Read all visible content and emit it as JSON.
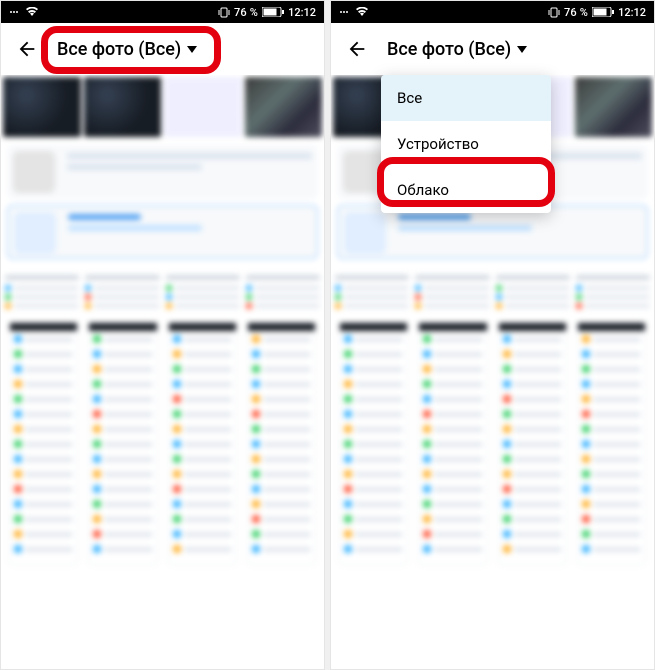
{
  "statusbar": {
    "battery_text": "76 %",
    "clock": "12:12"
  },
  "left_screen": {
    "title": "Все фото (Все)"
  },
  "right_screen": {
    "title": "Все фото (Все)",
    "dropdown": {
      "options": [
        {
          "label": "Все",
          "selected": true
        },
        {
          "label": "Устройство",
          "selected": false
        },
        {
          "label": "Облако",
          "selected": false
        }
      ]
    }
  }
}
